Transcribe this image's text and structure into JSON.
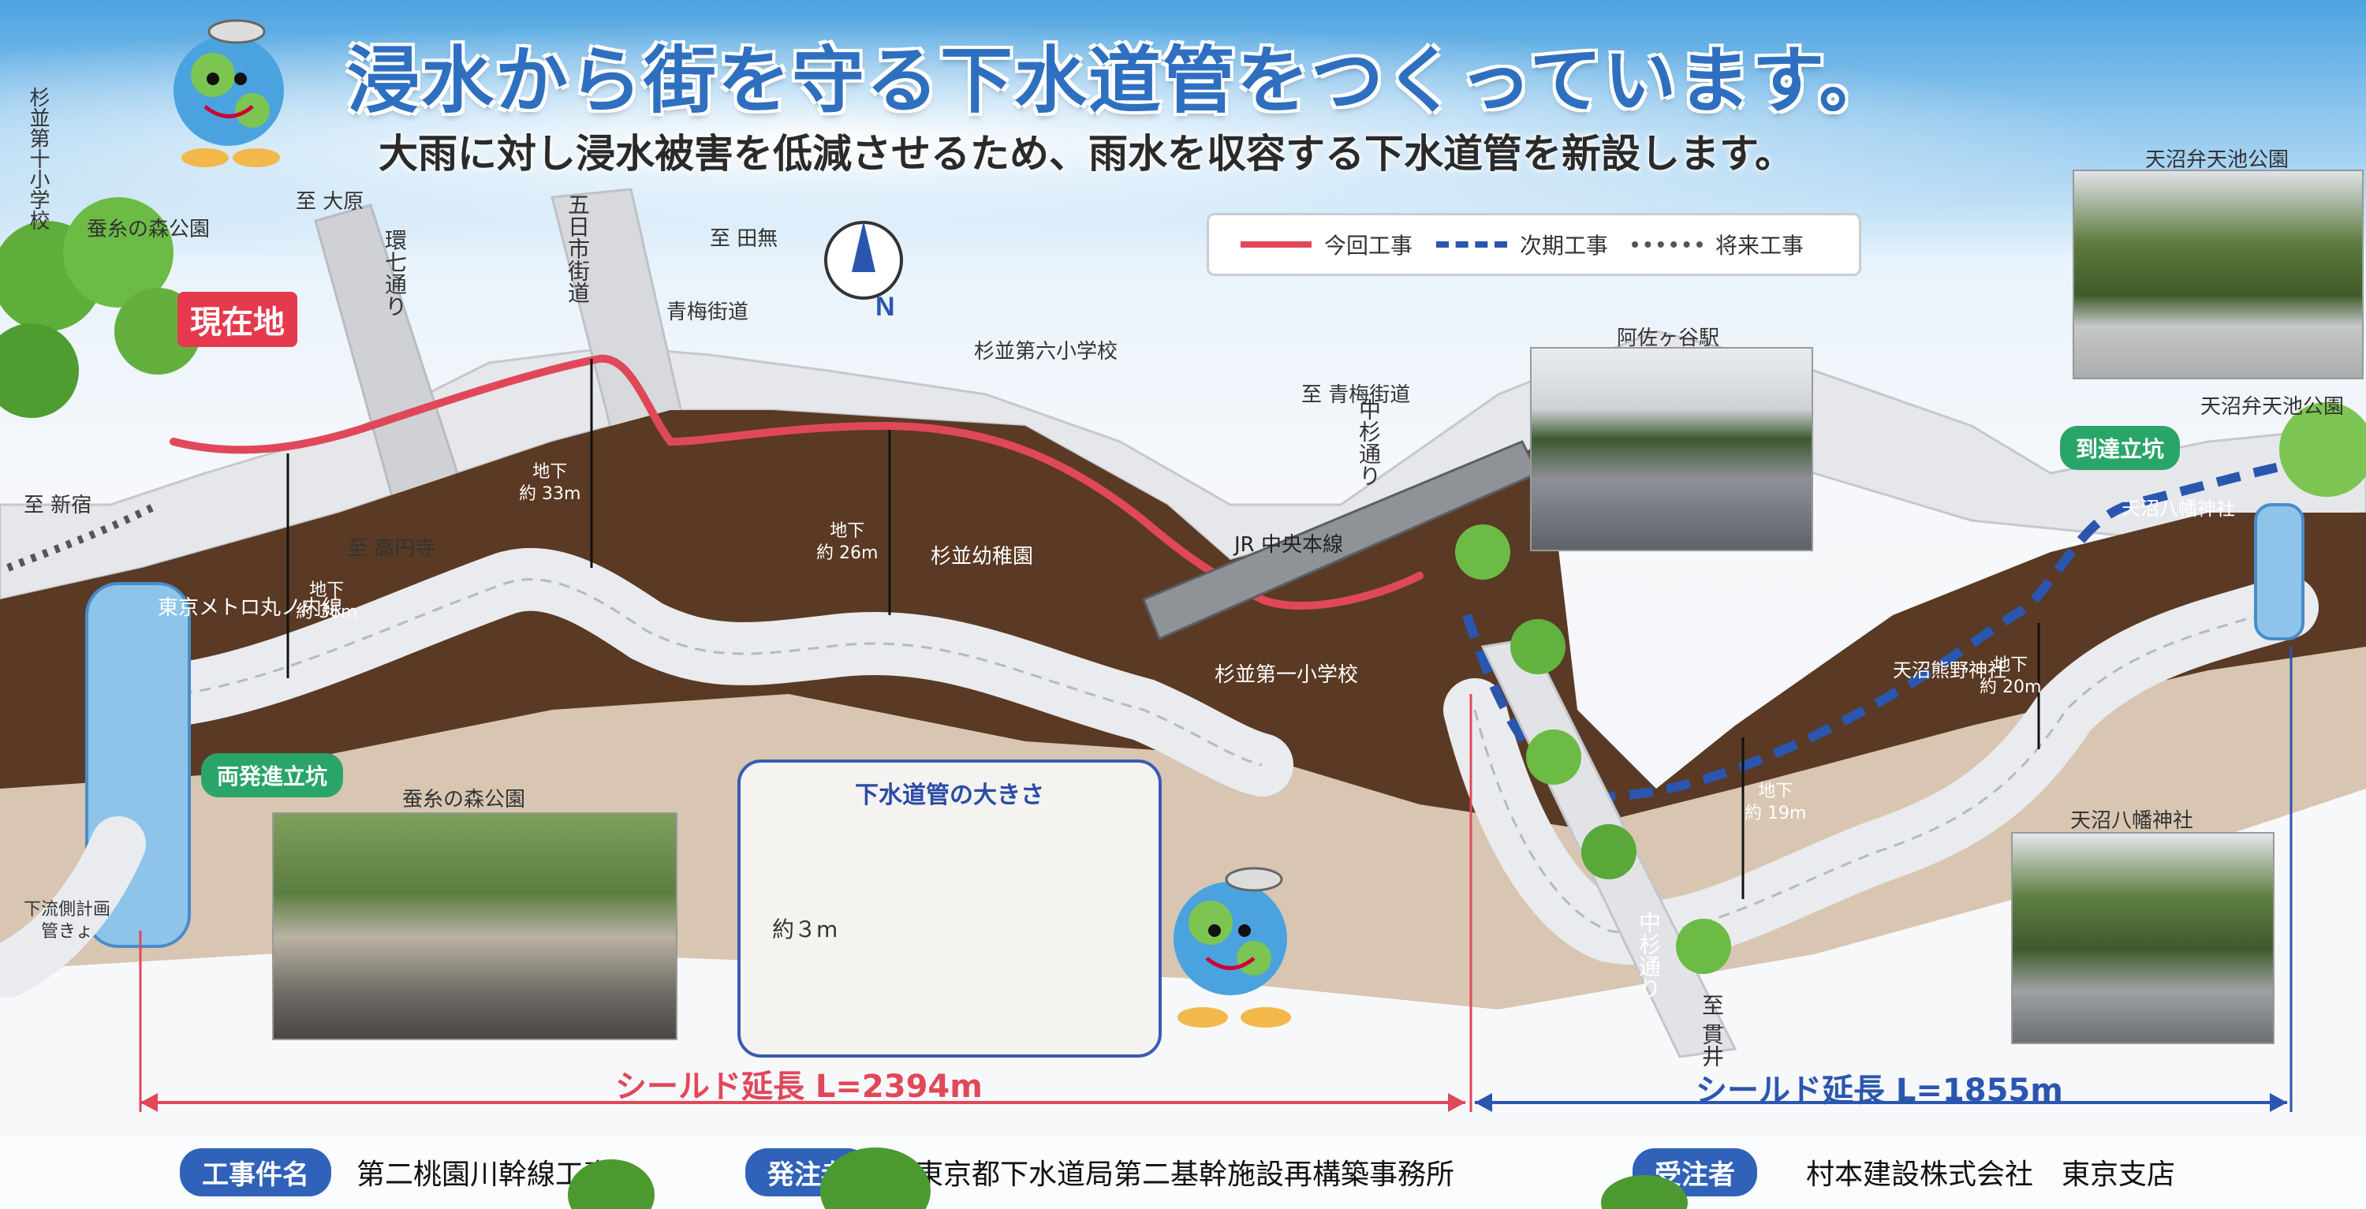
{
  "header": {
    "title": "浸水から街を守る下水道管をつくっています。",
    "subtitle": "大雨に対し浸水被害を低減させるため、雨水を収容する下水道管を新設します。"
  },
  "legend": {
    "current": "今回工事",
    "next": "次期工事",
    "future": "将来工事"
  },
  "colors": {
    "current": "#e0485a",
    "next": "#2a56b0",
    "future": "#555555",
    "shaft_badge": "#2aa56a",
    "footer_key": "#2f62b8"
  },
  "map_labels": {
    "here": "現在地",
    "suginami10": "杉並第十小学校",
    "kaiko_park_top": "蚕糸の森公園",
    "to_oohara": "至 大原",
    "kannana": "環七通り",
    "itsukaichi": "五日市街道",
    "to_tanashi": "至 田無",
    "oume": "青梅街道",
    "to_shinjuku": "至 新宿",
    "to_koenji": "至 高円寺",
    "metro": "東京メトロ丸ノ内線",
    "suginami6": "杉並第六小学校",
    "to_oume": "至 青梅街道",
    "nakasugi_top": "中杉通り",
    "jr": "JR 中央本線",
    "kindergarten": "杉並幼稚園",
    "suginami1": "杉並第一小学校",
    "asagaya": "阿佐ヶ谷駅",
    "benten_photo": "天沼弁天池公園",
    "benten_map": "天沼弁天池公園",
    "arrival_shaft": "到達立坑",
    "departure_shaft": "両発進立坑",
    "hachiman_map": "天沼八幡神社",
    "kumano": "天沼熊野神社",
    "hachiman_photo": "天沼八幡神社",
    "nakasugi_bottom": "中杉通り",
    "to_nukui": "至 貫井",
    "kaiko_park_photo": "蚕糸の森公園",
    "downstream": "下流側計画管きょ"
  },
  "depths": {
    "d36": "地下\n約 36m",
    "d33": "地下\n約 33m",
    "d26": "地下\n約 26m",
    "d19": "地下\n約 19m",
    "d20": "地下\n約 20m"
  },
  "pipe_size": {
    "title": "下水道管の大きさ",
    "diameter": "約３m"
  },
  "spans": {
    "left": "シールド延長 L=2394m",
    "right": "シールド延長 L=1855m"
  },
  "footer": {
    "project_key": "工事件名",
    "project_val": "第二桃園川幹線工事",
    "orderer_key": "発注者",
    "orderer_val": "東京都下水道局第二基幹施設再構築事務所",
    "contractor_key": "受注者",
    "contractor_val": "村本建設株式会社　東京支店"
  }
}
